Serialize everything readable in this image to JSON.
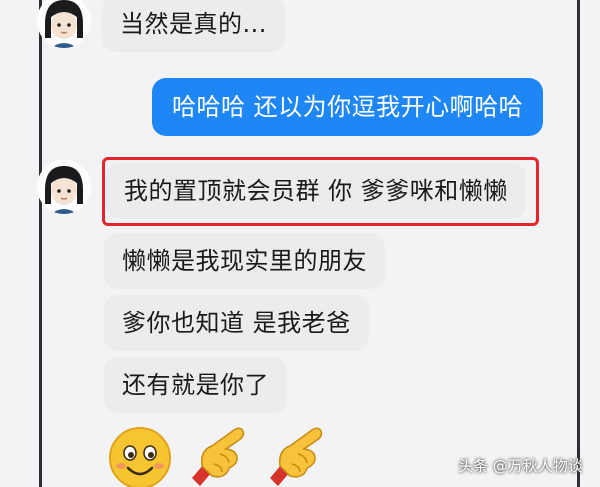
{
  "conversation": {
    "messages": [
      {
        "direction": "incoming",
        "text": "当然是真的..."
      },
      {
        "direction": "outgoing",
        "text": "哈哈哈 还以为你逗我开心啊哈哈"
      },
      {
        "direction": "incoming",
        "text": "我的置顶就会员群 你 爹爹咪和懒懒",
        "highlighted": true
      },
      {
        "direction": "incoming",
        "text": "懒懒是我现实里的朋友"
      },
      {
        "direction": "incoming",
        "text": "爹你也知道 是我老爸"
      },
      {
        "direction": "incoming",
        "text": "还有就是你了"
      }
    ],
    "emojis": [
      "smiling-face-emoji",
      "pointing-finger-emoji",
      "pointing-finger-emoji"
    ]
  },
  "colors": {
    "outgoing_bubble": "#1f86f5",
    "incoming_bubble": "#ececee",
    "highlight_border": "#e4252b"
  },
  "watermark": "头条 @万秋人物谈"
}
